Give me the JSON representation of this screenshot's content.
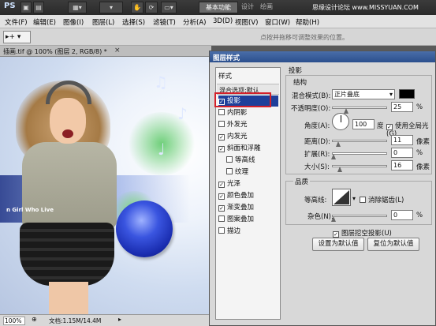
{
  "app": {
    "logo": "PS",
    "workspace_button": "基本功能",
    "workspace_tabs": [
      "设计",
      "绘画"
    ],
    "site_credit": "思缘设计论坛 www.MISSYUAN.COM"
  },
  "menu": {
    "items": [
      "文件(F)",
      "编辑(E)",
      "图像(I)",
      "图层(L)",
      "选择(S)",
      "滤镜(T)",
      "分析(A)",
      "3D(D)",
      "视图(V)",
      "窗口(W)",
      "帮助(H)"
    ]
  },
  "options_bar": {
    "tool_preset": "▸+ ▾",
    "hint": "点按并拖移可调整效果的位置。"
  },
  "document": {
    "tab_label": "插画.tif @ 100% (图层 2, RGB/8) *",
    "close_glyph": "×",
    "canvas_text": "n Girl Who Live",
    "zoom": "100%",
    "doc_info": "文档:1.15M/14.4M"
  },
  "dialog": {
    "title": "图层样式",
    "style_list_title": "样式",
    "blend_options": "混合选项:默认",
    "styles": [
      {
        "label": "投影",
        "checked": true,
        "selected": true
      },
      {
        "label": "内阴影",
        "checked": false,
        "selected": false
      },
      {
        "label": "外发光",
        "checked": false,
        "selected": false
      },
      {
        "label": "内发光",
        "checked": true,
        "selected": false
      },
      {
        "label": "斜面和浮雕",
        "checked": true,
        "selected": false
      },
      {
        "label": "等高线",
        "checked": false,
        "selected": false,
        "indent": true
      },
      {
        "label": "纹理",
        "checked": false,
        "selected": false,
        "indent": true
      },
      {
        "label": "光泽",
        "checked": true,
        "selected": false
      },
      {
        "label": "颜色叠加",
        "checked": true,
        "selected": false
      },
      {
        "label": "渐变叠加",
        "checked": true,
        "selected": false
      },
      {
        "label": "图案叠加",
        "checked": false,
        "selected": false
      },
      {
        "label": "描边",
        "checked": false,
        "selected": false
      }
    ],
    "drop_shadow": {
      "section_title": "投影",
      "structure_title": "结构",
      "blend_mode_label": "混合模式(B):",
      "blend_mode_value": "正片叠底",
      "shadow_color": "#000000",
      "opacity_label": "不透明度(O):",
      "opacity_value": "25",
      "opacity_unit": "%",
      "angle_label": "角度(A):",
      "angle_value": "100",
      "angle_unit": "度",
      "global_light_label": "使用全局光(G)",
      "global_light_checked": true,
      "distance_label": "距离(D):",
      "distance_value": "11",
      "distance_unit": "像素",
      "spread_label": "扩展(R):",
      "spread_value": "0",
      "spread_unit": "%",
      "size_label": "大小(S):",
      "size_value": "16",
      "size_unit": "像素"
    },
    "quality": {
      "title": "品质",
      "contour_label": "等高线:",
      "anti_alias_label": "消除锯齿(L)",
      "anti_alias_checked": false,
      "noise_label": "杂色(N):",
      "noise_value": "0",
      "noise_unit": "%"
    },
    "knockout_label": "图层挖空投影(U)",
    "knockout_checked": true,
    "set_default_button": "设置为默认值",
    "reset_default_button": "复位为默认值"
  },
  "colors": {
    "title_bar": "#2b4f8d",
    "selected_row": "#1e3f9a",
    "highlight_box": "#d4202a"
  }
}
